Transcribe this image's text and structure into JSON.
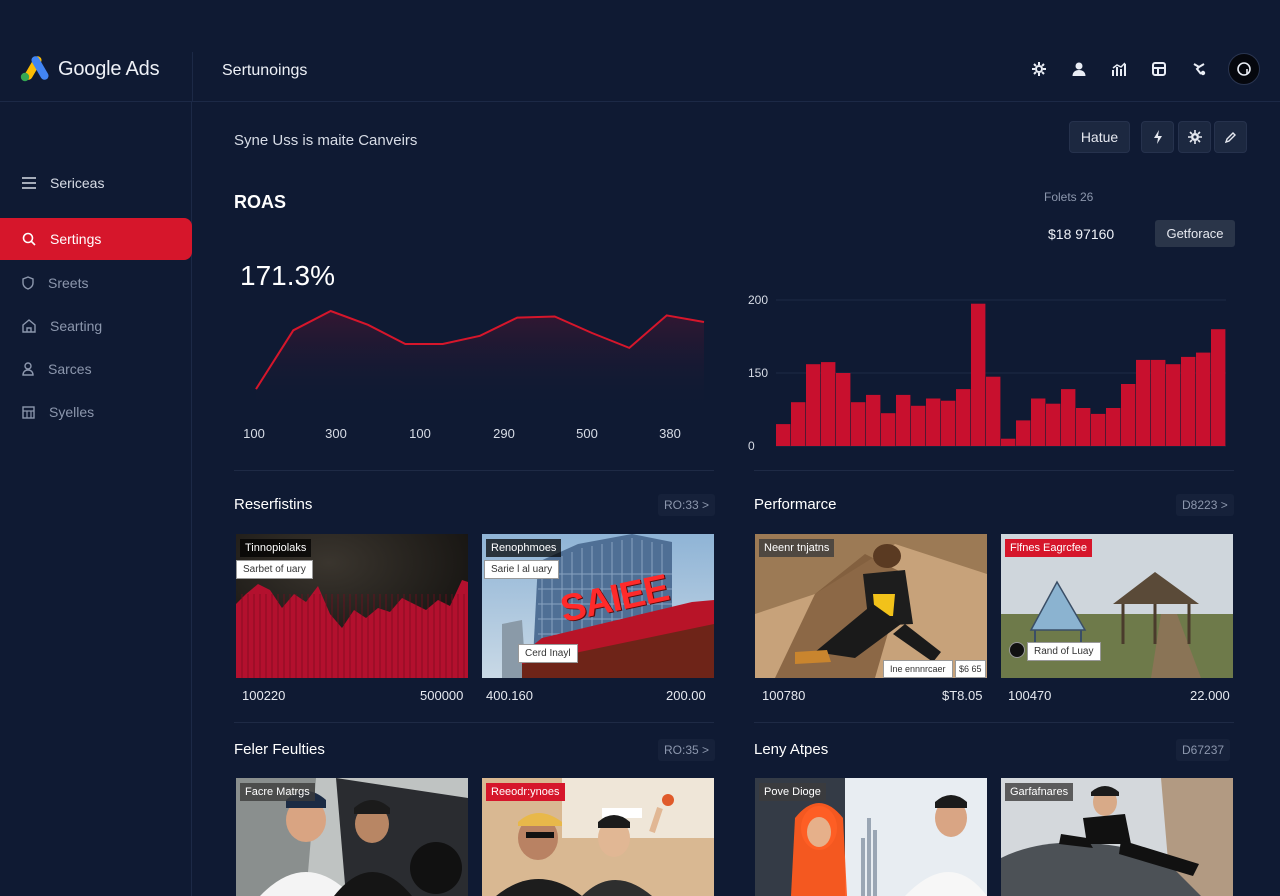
{
  "app": {
    "name": "Google Ads",
    "page_title": "Sertunoings"
  },
  "sidebar": {
    "items": [
      {
        "label": "Sericeas",
        "icon": "menu-icon",
        "active": false
      },
      {
        "label": "Sertings",
        "icon": "search-icon",
        "active": true
      },
      {
        "label": "Sreets",
        "icon": "shield-icon",
        "active": false
      },
      {
        "label": "Searting",
        "icon": "home-icon",
        "active": false
      },
      {
        "label": "Sarces",
        "icon": "user-icon",
        "active": false
      },
      {
        "label": "Syelles",
        "icon": "grid-icon",
        "active": false
      }
    ]
  },
  "header": {
    "subtitle": "Syne Uss is maite Canveirs",
    "toolbar": {
      "label_button": "Hatue"
    }
  },
  "roas": {
    "title": "ROAS",
    "value": "171.3%",
    "right_sub": "Folets 26",
    "right_value": "$18 97160",
    "performance_button": "Getforace"
  },
  "chart_data": [
    {
      "type": "line",
      "x": [
        "100",
        "300",
        "100",
        "290",
        "500",
        "380"
      ],
      "values": [
        38,
        145,
        180,
        155,
        120,
        120,
        135,
        168,
        170,
        140,
        113,
        172,
        160
      ],
      "title": "",
      "xlabel": "",
      "ylabel": "",
      "color": "#d6162b"
    },
    {
      "type": "bar",
      "yticks": [
        "200",
        "150",
        "0"
      ],
      "ylim": [
        0,
        200
      ],
      "values": [
        30,
        60,
        112,
        115,
        100,
        60,
        70,
        45,
        70,
        55,
        65,
        62,
        78,
        195,
        95,
        10,
        35,
        65,
        58,
        78,
        52,
        44,
        52,
        85,
        118,
        118,
        112,
        122,
        128,
        160
      ],
      "color": "#c8102e"
    }
  ],
  "sections": [
    {
      "title": "Reserfistins",
      "link": "RO:33 >",
      "cards": [
        {
          "tag": "Tinnopiolaks",
          "tag_style": "dark",
          "label": "Sarbet of uary",
          "num_left": "100220",
          "num_right": "500000"
        },
        {
          "tag": "Renophmoes",
          "tag_style": "dark",
          "label": "Sarie l al uary",
          "label2": "Cerd Inayl",
          "sign": "SAIEE",
          "num_left": "400.160",
          "num_right": "200.00"
        }
      ]
    },
    {
      "title": "Performarce",
      "link": "D8223 >",
      "cards": [
        {
          "tag": "Neenr tnjatns",
          "tag_style": "grey",
          "label": "Ine ennnrcaer",
          "label_extra": "$6 65",
          "num_left": "100780",
          "num_right": "$T8.05"
        },
        {
          "tag": "Flfnes Eagrcfee",
          "tag_style": "red",
          "label": "Rand of Luay",
          "num_left": "100470",
          "num_right": "22.000"
        }
      ]
    },
    {
      "title": "Feler Feulties",
      "link": "RO:35 >",
      "cards": [
        {
          "tag": "Facre Matrgs",
          "tag_style": "grey"
        },
        {
          "tag": "Reeodr:ynoes",
          "tag_style": "red"
        }
      ]
    },
    {
      "title": "Leny Atpes",
      "link": "D67237",
      "cards": [
        {
          "tag": "Pove Dioge",
          "tag_style": "grey"
        },
        {
          "tag": "Garfafnares",
          "tag_style": "grey"
        }
      ]
    }
  ]
}
